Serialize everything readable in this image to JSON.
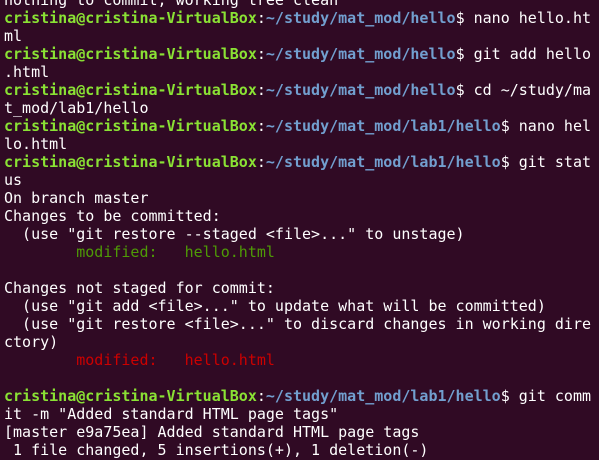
{
  "window": {
    "type": "terminal"
  },
  "colors": {
    "background": "#300a24",
    "text": "#ffffff",
    "prompt_user": "#8ae234",
    "prompt_path": "#729fcf",
    "staged": "#4e9a06",
    "unstaged": "#cc0000"
  },
  "terminal": {
    "lines": [
      {
        "segments": [
          {
            "cls": "plain",
            "text": "nothing to commit, working tree clean"
          }
        ]
      },
      {
        "segments": [
          {
            "cls": "user",
            "text": "cristina@cristina-VirtualBox"
          },
          {
            "cls": "plain",
            "text": ":"
          },
          {
            "cls": "path",
            "text": "~/study/mat_mod/hello"
          },
          {
            "cls": "plain",
            "text": "$ nano hello.ht"
          }
        ]
      },
      {
        "segments": [
          {
            "cls": "plain",
            "text": "ml"
          }
        ]
      },
      {
        "segments": [
          {
            "cls": "user",
            "text": "cristina@cristina-VirtualBox"
          },
          {
            "cls": "plain",
            "text": ":"
          },
          {
            "cls": "path",
            "text": "~/study/mat_mod/hello"
          },
          {
            "cls": "plain",
            "text": "$ git add hello"
          }
        ]
      },
      {
        "segments": [
          {
            "cls": "plain",
            "text": ".html"
          }
        ]
      },
      {
        "segments": [
          {
            "cls": "user",
            "text": "cristina@cristina-VirtualBox"
          },
          {
            "cls": "plain",
            "text": ":"
          },
          {
            "cls": "path",
            "text": "~/study/mat_mod/hello"
          },
          {
            "cls": "plain",
            "text": "$ cd ~/study/ma"
          }
        ]
      },
      {
        "segments": [
          {
            "cls": "plain",
            "text": "t_mod/lab1/hello"
          }
        ]
      },
      {
        "segments": [
          {
            "cls": "user",
            "text": "cristina@cristina-VirtualBox"
          },
          {
            "cls": "plain",
            "text": ":"
          },
          {
            "cls": "path",
            "text": "~/study/mat_mod/lab1/hello"
          },
          {
            "cls": "plain",
            "text": "$ nano hel"
          }
        ]
      },
      {
        "segments": [
          {
            "cls": "plain",
            "text": "lo.html"
          }
        ]
      },
      {
        "segments": [
          {
            "cls": "user",
            "text": "cristina@cristina-VirtualBox"
          },
          {
            "cls": "plain",
            "text": ":"
          },
          {
            "cls": "path",
            "text": "~/study/mat_mod/lab1/hello"
          },
          {
            "cls": "plain",
            "text": "$ git stat"
          }
        ]
      },
      {
        "segments": [
          {
            "cls": "plain",
            "text": "us"
          }
        ]
      },
      {
        "segments": [
          {
            "cls": "plain",
            "text": "On branch master"
          }
        ]
      },
      {
        "segments": [
          {
            "cls": "plain",
            "text": "Changes to be committed:"
          }
        ]
      },
      {
        "segments": [
          {
            "cls": "plain",
            "text": "  (use \"git restore --staged <file>...\" to unstage)"
          }
        ]
      },
      {
        "segments": [
          {
            "cls": "plain",
            "text": "        "
          },
          {
            "cls": "green",
            "text": "modified:   hello.html"
          }
        ]
      },
      {
        "segments": [
          {
            "cls": "plain",
            "text": ""
          }
        ]
      },
      {
        "segments": [
          {
            "cls": "plain",
            "text": "Changes not staged for commit:"
          }
        ]
      },
      {
        "segments": [
          {
            "cls": "plain",
            "text": "  (use \"git add <file>...\" to update what will be committed)"
          }
        ]
      },
      {
        "segments": [
          {
            "cls": "plain",
            "text": "  (use \"git restore <file>...\" to discard changes in working dire"
          }
        ]
      },
      {
        "segments": [
          {
            "cls": "plain",
            "text": "ctory)"
          }
        ]
      },
      {
        "segments": [
          {
            "cls": "plain",
            "text": "        "
          },
          {
            "cls": "red",
            "text": "modified:   hello.html"
          }
        ]
      },
      {
        "segments": [
          {
            "cls": "plain",
            "text": ""
          }
        ]
      },
      {
        "segments": [
          {
            "cls": "user",
            "text": "cristina@cristina-VirtualBox"
          },
          {
            "cls": "plain",
            "text": ":"
          },
          {
            "cls": "path",
            "text": "~/study/mat_mod/lab1/hello"
          },
          {
            "cls": "plain",
            "text": "$ git comm"
          }
        ]
      },
      {
        "segments": [
          {
            "cls": "plain",
            "text": "it -m \"Added standard HTML page tags\""
          }
        ]
      },
      {
        "segments": [
          {
            "cls": "plain",
            "text": "[master e9a75ea] Added standard HTML page tags"
          }
        ]
      },
      {
        "segments": [
          {
            "cls": "plain",
            "text": " 1 file changed, 5 insertions(+), 1 deletion(-)"
          }
        ]
      }
    ]
  }
}
